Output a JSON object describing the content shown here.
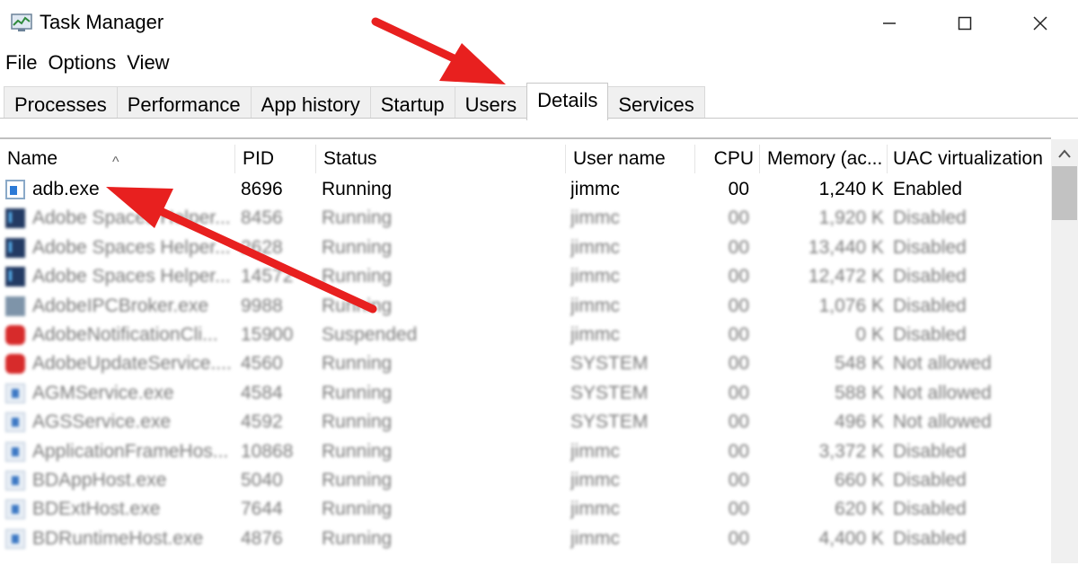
{
  "window": {
    "title": "Task Manager"
  },
  "menu": [
    "File",
    "Options",
    "View"
  ],
  "tabs": [
    {
      "label": "Processes"
    },
    {
      "label": "Performance"
    },
    {
      "label": "App history"
    },
    {
      "label": "Startup"
    },
    {
      "label": "Users"
    },
    {
      "label": "Details",
      "active": true
    },
    {
      "label": "Services"
    }
  ],
  "columns": {
    "name": "Name",
    "pid": "PID",
    "status": "Status",
    "user": "User name",
    "cpu": "CPU",
    "memory": "Memory (ac...",
    "uac": "UAC virtualization"
  },
  "sort_indicator": "^",
  "rows": [
    {
      "name": "adb.exe",
      "pid": "8696",
      "status": "Running",
      "user": "jimmc",
      "cpu": "00",
      "memory": "1,240 K",
      "uac": "Enabled",
      "icon": "exe-icon",
      "sharp": true
    },
    {
      "name": "Adobe Spaces Helper...",
      "pid": "8456",
      "status": "Running",
      "user": "jimmc",
      "cpu": "00",
      "memory": "1,920 K",
      "uac": "Disabled",
      "icon": "photoshop-icon"
    },
    {
      "name": "Adobe Spaces Helper...",
      "pid": "2628",
      "status": "Running",
      "user": "jimmc",
      "cpu": "00",
      "memory": "13,440 K",
      "uac": "Disabled",
      "icon": "photoshop-icon"
    },
    {
      "name": "Adobe Spaces Helper...",
      "pid": "14572",
      "status": "Running",
      "user": "jimmc",
      "cpu": "00",
      "memory": "12,472 K",
      "uac": "Disabled",
      "icon": "photoshop-icon"
    },
    {
      "name": "AdobeIPCBroker.exe",
      "pid": "9988",
      "status": "Running",
      "user": "jimmc",
      "cpu": "00",
      "memory": "1,076 K",
      "uac": "Disabled",
      "icon": "ipc-broker-icon"
    },
    {
      "name": "AdobeNotificationCli...",
      "pid": "15900",
      "status": "Suspended",
      "user": "jimmc",
      "cpu": "00",
      "memory": "0 K",
      "uac": "Disabled",
      "icon": "adobe-cc-icon"
    },
    {
      "name": "AdobeUpdateService....",
      "pid": "4560",
      "status": "Running",
      "user": "SYSTEM",
      "cpu": "00",
      "memory": "548 K",
      "uac": "Not allowed",
      "icon": "adobe-cc-icon"
    },
    {
      "name": "AGMService.exe",
      "pid": "4584",
      "status": "Running",
      "user": "SYSTEM",
      "cpu": "00",
      "memory": "588 K",
      "uac": "Not allowed",
      "icon": "service-icon"
    },
    {
      "name": "AGSService.exe",
      "pid": "4592",
      "status": "Running",
      "user": "SYSTEM",
      "cpu": "00",
      "memory": "496 K",
      "uac": "Not allowed",
      "icon": "service-icon"
    },
    {
      "name": "ApplicationFrameHos...",
      "pid": "10868",
      "status": "Running",
      "user": "jimmc",
      "cpu": "00",
      "memory": "3,372 K",
      "uac": "Disabled",
      "icon": "service-icon"
    },
    {
      "name": "BDAppHost.exe",
      "pid": "5040",
      "status": "Running",
      "user": "jimmc",
      "cpu": "00",
      "memory": "660 K",
      "uac": "Disabled",
      "icon": "service-icon"
    },
    {
      "name": "BDExtHost.exe",
      "pid": "7644",
      "status": "Running",
      "user": "jimmc",
      "cpu": "00",
      "memory": "620 K",
      "uac": "Disabled",
      "icon": "service-icon"
    },
    {
      "name": "BDRuntimeHost.exe",
      "pid": "4876",
      "status": "Running",
      "user": "jimmc",
      "cpu": "00",
      "memory": "4,400 K",
      "uac": "Disabled",
      "icon": "service-icon"
    }
  ],
  "annotation_color": "#e8201f",
  "accent_colors": {
    "tab_border": "#c8c8c8",
    "header_bg": "#ffffff"
  }
}
